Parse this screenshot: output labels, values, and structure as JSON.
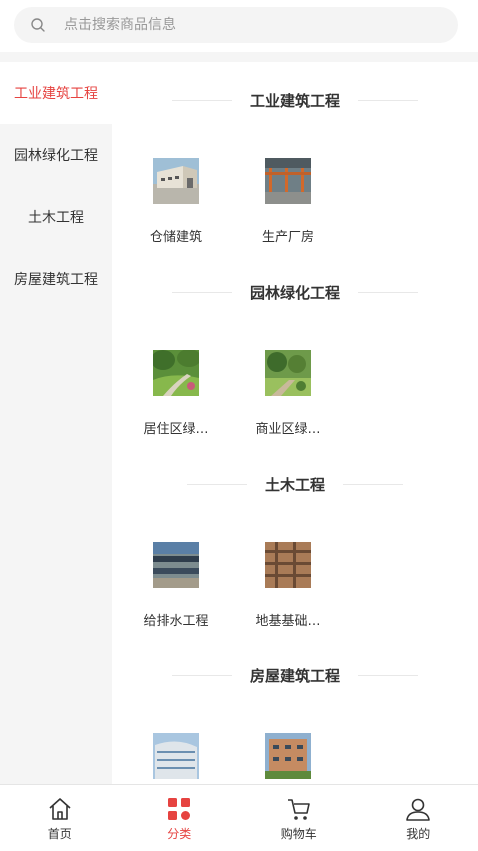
{
  "search": {
    "placeholder": "点击搜索商品信息"
  },
  "sidebar": {
    "items": [
      {
        "label": "工业建筑工程"
      },
      {
        "label": "园林绿化工程"
      },
      {
        "label": "土木工程"
      },
      {
        "label": "房屋建筑工程"
      }
    ]
  },
  "sections": [
    {
      "title": "工业建筑工程",
      "products": [
        {
          "name": "仓储建筑"
        },
        {
          "name": "生产厂房"
        }
      ]
    },
    {
      "title": "园林绿化工程",
      "products": [
        {
          "name": "居住区绿…"
        },
        {
          "name": "商业区绿…"
        }
      ]
    },
    {
      "title": "土木工程",
      "products": [
        {
          "name": "给排水工程"
        },
        {
          "name": "地基基础…"
        }
      ]
    },
    {
      "title": "房屋建筑工程",
      "products": [
        {
          "name": ""
        },
        {
          "name": ""
        }
      ]
    }
  ],
  "tabbar": {
    "items": [
      {
        "label": "首页",
        "icon": "home-icon"
      },
      {
        "label": "分类",
        "icon": "category-icon"
      },
      {
        "label": "购物车",
        "icon": "cart-icon"
      },
      {
        "label": "我的",
        "icon": "user-icon"
      }
    ]
  },
  "colors": {
    "accent": "#e64340",
    "sidebar_bg": "#f5f5f5"
  }
}
